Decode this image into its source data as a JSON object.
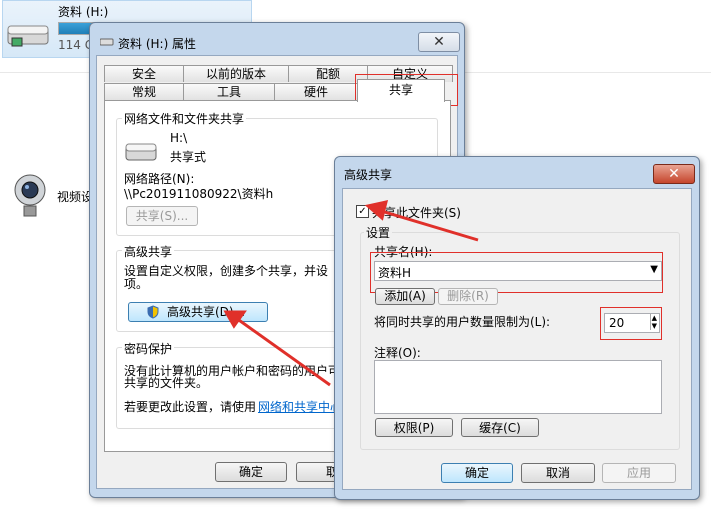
{
  "explorer": {
    "drive_name": "资料 (H:)",
    "drive_size": "114 G",
    "camera_label": "视频设"
  },
  "props": {
    "title": "资料 (H:) 属性",
    "tabs_row1": [
      "安全",
      "以前的版本",
      "配额",
      "自定义"
    ],
    "tabs_row2": [
      "常规",
      "工具",
      "硬件",
      "共享"
    ],
    "net_share_group": "网络文件和文件夹共享",
    "drive_label": "H:\\",
    "share_state": "共享式",
    "net_path_label": "网络路径(N):",
    "net_path": "\\\\Pc201911080922\\资料h",
    "share_btn": "共享(S)...",
    "adv_group": "高级共享",
    "adv_desc_1": "设置自定义权限，创建多个共享，并设",
    "adv_desc_2": "项。",
    "adv_btn": "高级共享(D)...",
    "pwd_group": "密码保护",
    "pwd_desc_1": "没有此计算机的用户帐户和密码的用户可",
    "pwd_desc_2": "共享的文件夹。",
    "pwd_change": "若要更改此设置，请使用",
    "pwd_link": "网络和共享中心",
    "ok": "确定",
    "cancel": "取"
  },
  "adv": {
    "title": "高级共享",
    "share_checkbox": "共享此文件夹(S)",
    "settings_group": "设置",
    "share_name_label": "共享名(H):",
    "share_name_value": "资料H",
    "add_btn": "添加(A)",
    "remove_btn": "删除(R)",
    "limit_label": "将同时共享的用户数量限制为(L):",
    "limit_value": "20",
    "comment_label": "注释(O):",
    "perm_btn": "权限(P)",
    "cache_btn": "缓存(C)",
    "ok": "确定",
    "cancel": "取消",
    "apply": "应用"
  },
  "colors": {
    "annotation_red": "#e0302a",
    "title_bar": "#c4d7ec"
  }
}
